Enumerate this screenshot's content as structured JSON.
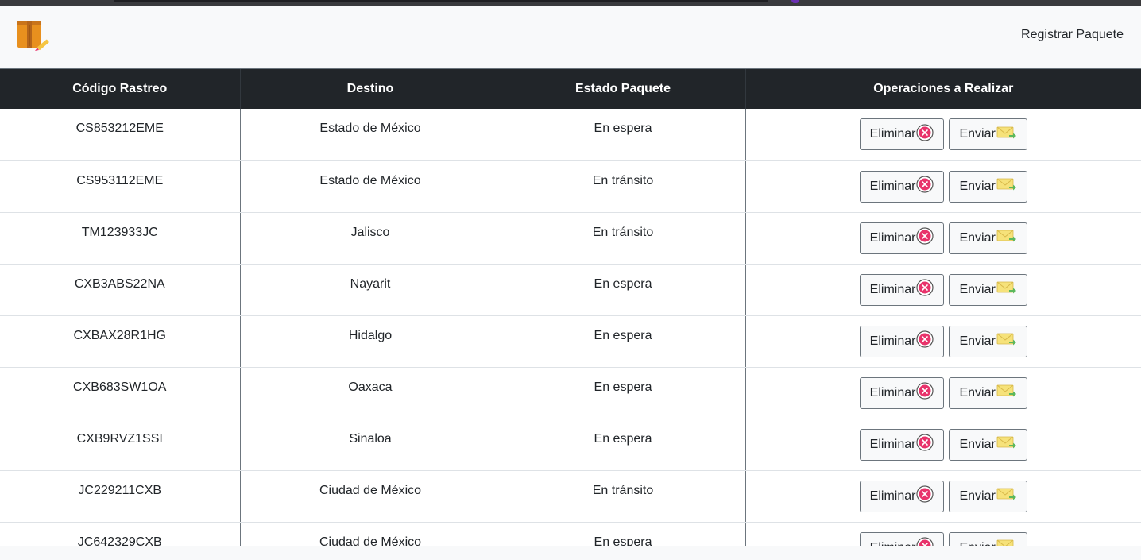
{
  "navbar": {
    "logo_icon": "package-pencil-icon",
    "link_label": "Registrar Paquete"
  },
  "table": {
    "headers": [
      "Código Rastreo",
      "Destino",
      "Estado Paquete",
      "Operaciones a Realizar"
    ],
    "delete_label": "Eliminar",
    "send_label": "Enviar",
    "delete_icon": "close-circle-icon",
    "send_icon": "envelope-send-icon",
    "rows": [
      {
        "code": "CS853212EME",
        "destination": "Estado de México",
        "status": "En espera"
      },
      {
        "code": "CS953112EME",
        "destination": "Estado de México",
        "status": "En tránsito"
      },
      {
        "code": "TM123933JC",
        "destination": "Jalisco",
        "status": "En tránsito"
      },
      {
        "code": "CXB3ABS22NA",
        "destination": "Nayarit",
        "status": "En espera"
      },
      {
        "code": "CXBAX28R1HG",
        "destination": "Hidalgo",
        "status": "En espera"
      },
      {
        "code": "CXB683SW1OA",
        "destination": "Oaxaca",
        "status": "En espera"
      },
      {
        "code": "CXB9RVZ1SSI",
        "destination": "Sinaloa",
        "status": "En espera"
      },
      {
        "code": "JC229211CXB",
        "destination": "Ciudad de México",
        "status": "En tránsito"
      },
      {
        "code": "JC642329CXB",
        "destination": "Ciudad de México",
        "status": "En espera"
      }
    ]
  },
  "colors": {
    "header_bg": "#212529",
    "delete_icon": "#e8336b",
    "send_icon_envelope": "#f6e27a",
    "send_icon_arrow": "#5cb85c"
  }
}
